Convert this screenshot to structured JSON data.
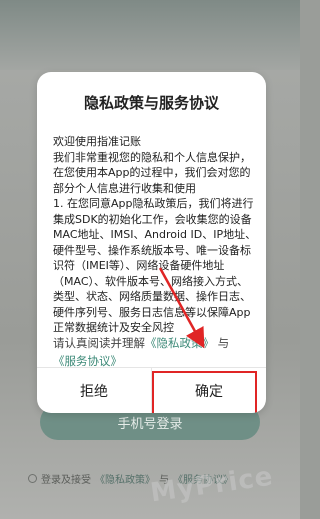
{
  "background": {
    "login_button_label": "手机号登录",
    "agree_prefix": "登录及接受",
    "agree_privacy": "《隐私政策》",
    "agree_and": "与",
    "agree_service": "《服务协议》"
  },
  "dialog": {
    "title": "隐私政策与服务协议",
    "body_paragraphs": [
      "欢迎使用指准记账",
      "我们非常重视您的隐私和个人信息保护，在您使用本App的过程中，我们会对您的部分个人信息进行收集和使用",
      "1. 在您同意App隐私政策后，我们将进行集成SDK的初始化工作，会收集您的设备MAC地址、IMSI、Android ID、IP地址、硬件型号、操作系统版本号、唯一设备标识符（IMEI等）、网络设备硬件地址（MAC）、软件版本号、网络接入方式、类型、状态、网络质量数据、操作日志、硬件序列号、服务日志信息等以保障App正常数据统计及安全风控"
    ],
    "read_prefix": "请认真阅读并理解",
    "read_privacy": "《隐私政策》",
    "read_and": "与",
    "read_service": "《服务协议》",
    "reject_label": "拒绝",
    "confirm_label": "确定"
  },
  "colors": {
    "accent_link": "#3d8a78",
    "highlight_red": "#e02525"
  },
  "watermark_text": "MyPrice"
}
